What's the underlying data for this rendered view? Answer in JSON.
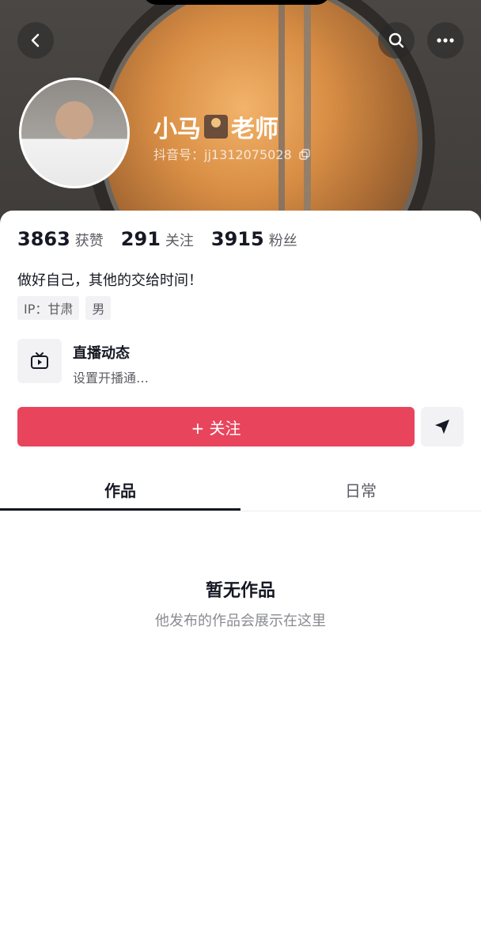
{
  "profile": {
    "name_part1": "小马",
    "name_part2": "老师",
    "name_emoji": "teacher-emoji",
    "douyin_id": "抖音号：jj1312075028",
    "bio": "做好自己，其他的交给时间！",
    "tags": [
      "IP：甘肃",
      "男"
    ]
  },
  "stats": [
    {
      "value": "3863",
      "label": "获赞"
    },
    {
      "value": "291",
      "label": "关注"
    },
    {
      "value": "3915",
      "label": "粉丝"
    }
  ],
  "live": {
    "title": "直播动态",
    "subtitle": "设置开播通…",
    "icon": "tv-icon"
  },
  "actions": {
    "follow_label": "+ 关注",
    "share_icon": "send-icon"
  },
  "tabs": [
    {
      "label": "作品",
      "active": true
    },
    {
      "label": "日常",
      "active": false
    }
  ],
  "empty": {
    "title": "暂无作品",
    "subtitle": "他发布的作品会展示在这里"
  },
  "header_icons": [
    "back-icon",
    "search-icon",
    "more-icon"
  ],
  "colors": {
    "accent": "#e8455c",
    "text_primary": "#161823",
    "text_secondary": "#5c5d63",
    "chip_bg": "#f2f2f4"
  }
}
